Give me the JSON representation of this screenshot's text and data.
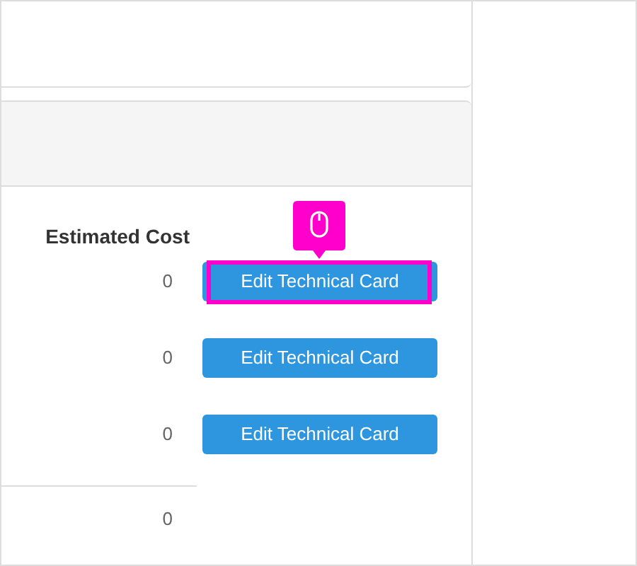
{
  "table": {
    "columns": [
      {
        "label": "Estimated Cost"
      }
    ],
    "rows": [
      {
        "estimated_cost": "0",
        "action": "Edit Technical Card",
        "highlighted": true
      },
      {
        "estimated_cost": "0",
        "action": "Edit Technical Card",
        "highlighted": false
      },
      {
        "estimated_cost": "0",
        "action": "Edit Technical Card",
        "highlighted": false
      }
    ],
    "total": {
      "estimated_cost": "0"
    }
  }
}
